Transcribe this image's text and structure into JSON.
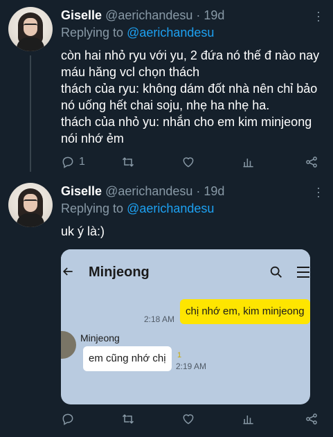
{
  "tweets": [
    {
      "name": "Giselle",
      "handle": "@aerichandesu · 19d",
      "replying_prefix": "Replying to",
      "replying_to": "@aerichandesu",
      "lines": [
        "còn hai nhỏ ryu với yu, 2 đứa nó thế đ nào nay máu hăng vcl chọn thách",
        "thách của ryu: không dám đốt nhà nên chỉ bảo nó uống hết chai soju, nhẹ ha nhẹ ha.",
        "thách của nhỏ yu: nhắn cho em kim minjeong nói nhớ ẻm"
      ],
      "reply_count": "1",
      "icons": [
        "reply-icon",
        "retweet-icon",
        "like-icon",
        "analytics-icon",
        "share-icon"
      ]
    },
    {
      "name": "Giselle",
      "handle": "@aerichandesu · 19d",
      "replying_prefix": "Replying to",
      "replying_to": "@aerichandesu",
      "lines": [
        "uk ý là:)"
      ],
      "reply_count": "",
      "icons": [
        "reply-icon",
        "retweet-icon",
        "like-icon",
        "analytics-icon",
        "share-icon"
      ]
    }
  ],
  "media": {
    "contact_name": "Minjeong",
    "outgoing_message": "chị nhớ em, kim minjeong",
    "outgoing_time": "2:18 AM",
    "incoming_sender": "Minjeong",
    "incoming_message": "em cũng nhớ chị",
    "incoming_unread": "1",
    "incoming_time": "2:19 AM"
  },
  "colors": {
    "background": "#15202b",
    "secondary_text": "#8899a6",
    "link": "#1da1f2",
    "chat_background": "#b9cbe0",
    "outgoing_bubble": "#fee500"
  }
}
